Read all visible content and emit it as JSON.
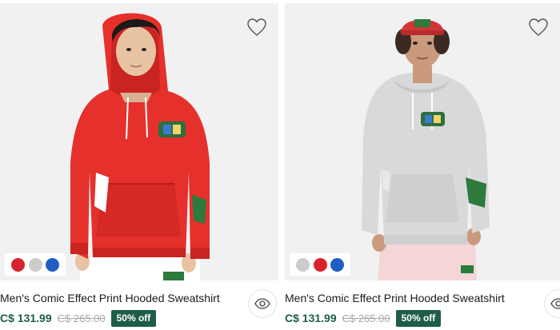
{
  "products": [
    {
      "title": "Men's Comic Effect Print Hooded Sweatshirt",
      "price": "C$ 131.99",
      "original_price": "C$ 265.00",
      "discount_badge": "50% off",
      "hoodie_color": "#e5302c",
      "swatches": [
        "#d8232e",
        "#cccccc",
        "#1f5fc4"
      ],
      "icons": [
        "heart-outline-icon",
        "eye-icon"
      ]
    },
    {
      "title": "Men's Comic Effect Print Hooded Sweatshirt",
      "price": "C$ 131.99",
      "original_price": "C$ 265.00",
      "discount_badge": "50% off",
      "hoodie_color": "#d9d9db",
      "swatches": [
        "#cccccc",
        "#d8232e",
        "#1f5fc4"
      ],
      "icons": [
        "heart-outline-icon",
        "eye-icon"
      ]
    }
  ],
  "colors": {
    "price_green": "#1e5d46",
    "strike_gray": "#a8a8a8",
    "photo_bg": "#f1f1f1"
  }
}
